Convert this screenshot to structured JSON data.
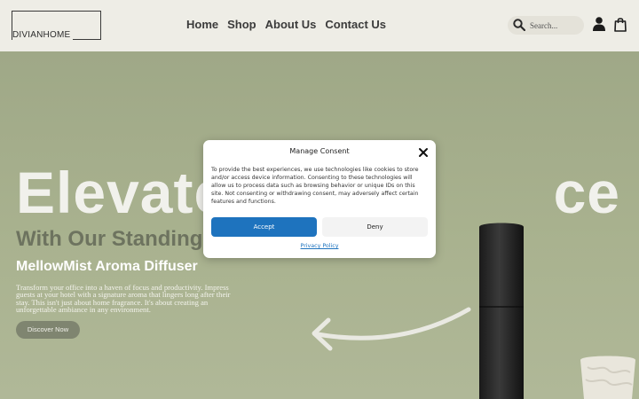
{
  "header": {
    "logo_text": "DIVIANHOME",
    "nav": [
      "Home",
      "Shop",
      "About Us",
      "Contact Us"
    ],
    "search_placeholder": "Search...",
    "icons": [
      "search-icon",
      "user-icon",
      "cart-icon"
    ]
  },
  "hero": {
    "headline": "Elevate                   ce",
    "subhead": "With Our Standing",
    "product": "MellowMist Aroma Diffuser",
    "description": "Transform your office into a haven of focus and productivity. Impress guests at your hotel with a signature aroma that lingers long after their stay. This isn't just about home fragrance. It's about creating an unforgettable ambiance in any environment.",
    "cta_label": "Discover Now"
  },
  "consent_modal": {
    "title": "Manage Consent",
    "body": "To provide the best experiences, we use technologies like cookies to store and/or access device information. Consenting to these technologies will allow us to process data such as browsing behavior or unique IDs on this site. Not consenting or withdrawing consent, may adversely affect certain features and functions.",
    "accept_label": "Accept",
    "deny_label": "Deny",
    "privacy_link": "Privacy Policy",
    "accent_color": "#1e73be"
  }
}
